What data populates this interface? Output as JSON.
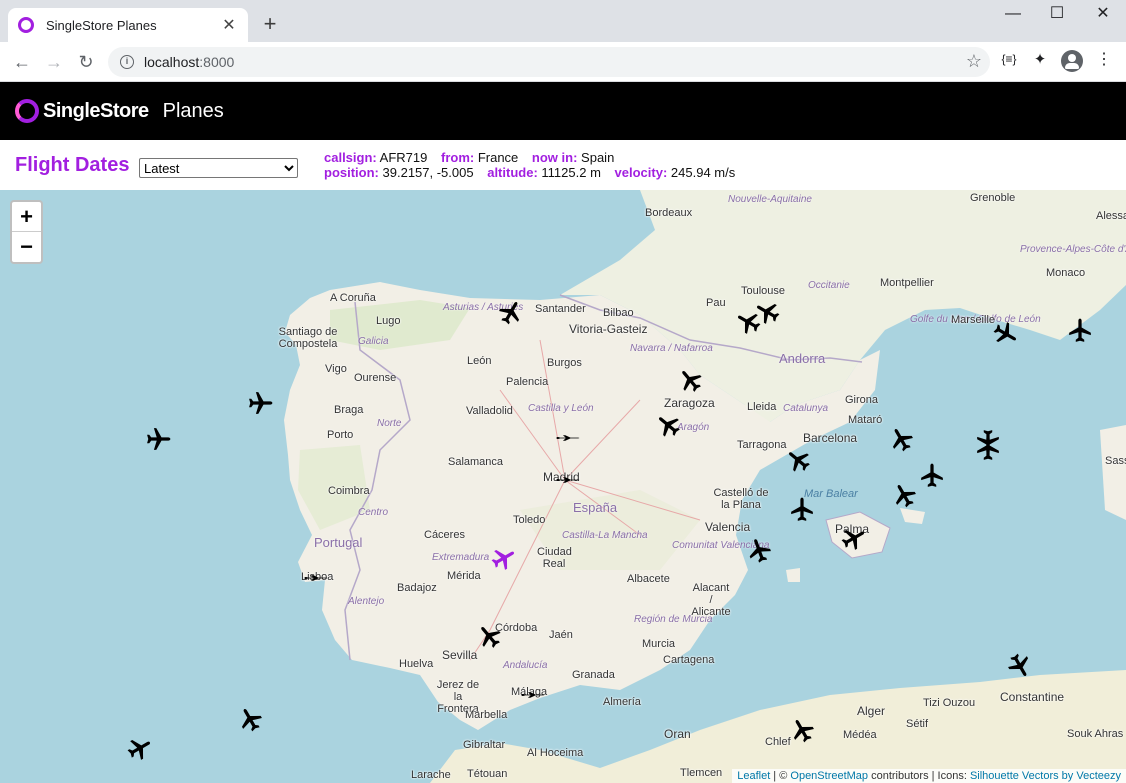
{
  "browser": {
    "tab_title": "SingleStore Planes",
    "url_host": "localhost",
    "url_port": ":8000"
  },
  "app": {
    "brand": "SingleStore",
    "title": "Planes",
    "accent_color": "#a21fe0"
  },
  "controls": {
    "flight_dates_label": "Flight Dates",
    "date_selected": "Latest"
  },
  "selected_flight": {
    "callsign_label": "callsign:",
    "callsign": "AFR719",
    "from_label": "from:",
    "from": "France",
    "now_in_label": "now in:",
    "now_in": "Spain",
    "position_label": "position:",
    "position": "39.2157, -5.005",
    "altitude_label": "altitude:",
    "altitude": "11125.2 m",
    "velocity_label": "velocity:",
    "velocity": "245.94 m/s"
  },
  "map": {
    "zoom_in": "+",
    "zoom_out": "−",
    "attribution": {
      "leaflet": "Leaflet",
      "sep1": " | © ",
      "osm": "OpenStreetMap",
      "contrib": " contributors | Icons: ",
      "icons": "Silhouette Vectors by Vecteezy"
    },
    "countries": [
      "España",
      "Portugal",
      "Andorra"
    ],
    "cities": [
      "Bordeaux",
      "Toulouse",
      "Pau",
      "Montpellier",
      "Marseille",
      "Monaco",
      "Grenoble",
      "Alessa",
      "A Coruña",
      "Lugo",
      "Santiago de Compostela",
      "Vigo",
      "Ourense",
      "Santander",
      "Bilbao",
      "Vitoria-Gasteiz",
      "León",
      "Burgos",
      "Palencia",
      "Valladolid",
      "Braga",
      "Porto",
      "Zaragoza",
      "Lleida",
      "Girona",
      "Barcelona",
      "Tarragona",
      "Mataró",
      "Salamanca",
      "Madrid",
      "Coimbra",
      "Toledo",
      "Castelló de la Plana",
      "Cáceres",
      "Ciudad Real",
      "Valencia",
      "Palma",
      "Lisboa",
      "Mérida",
      "Badajoz",
      "Albacete",
      "Alacant / Alicante",
      "Córdoba",
      "Jaén",
      "Murcia",
      "Sevilla",
      "Huelva",
      "Granada",
      "Cartagena",
      "Jerez de la Frontera",
      "Málaga",
      "Almería",
      "Marbella",
      "Gibraltar",
      "Constantine",
      "Alger",
      "Sétif",
      "Tizi Ouzou",
      "Médéa",
      "Oran",
      "Chlef",
      "Tétouan",
      "Larache",
      "Tlemcen",
      "Al Hoceima",
      "Souk Ahras",
      "Sass"
    ],
    "regions": [
      "Nouvelle-Aquitaine",
      "Occitanie",
      "Provence-Alpes-Côte d'Azur",
      "Asturias / Asturies",
      "Galicia",
      "Castilla y León",
      "Navarra / Nafarroa",
      "Aragón",
      "Catalunya",
      "Golfe du Lion / Golfo de León",
      "Norte",
      "Centro",
      "Extremadura",
      "Castilla-La Mancha",
      "Comunitat Valenciana",
      "Alentejo",
      "Región de Murcia",
      "Andalucía"
    ],
    "seas": [
      "Mar Balear"
    ],
    "selected_plane_color": "#a21fe0",
    "plane_color": "#000000"
  }
}
